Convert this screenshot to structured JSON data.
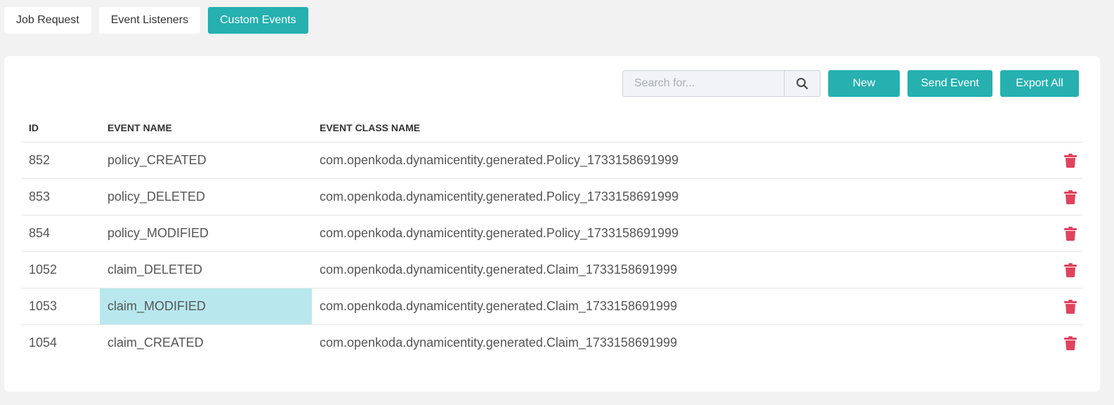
{
  "tabs": [
    {
      "label": "Job Request",
      "active": false
    },
    {
      "label": "Event Listeners",
      "active": false
    },
    {
      "label": "Custom Events",
      "active": true
    }
  ],
  "toolbar": {
    "search_placeholder": "Search for...",
    "search_icon": "search-icon",
    "new_label": "New",
    "send_event_label": "Send Event",
    "export_all_label": "Export All"
  },
  "table": {
    "headers": [
      "ID",
      "EVENT NAME",
      "EVENT CLASS NAME"
    ],
    "rows": [
      {
        "id": "852",
        "name": "policy_CREATED",
        "class_name": "com.openkoda.dynamicentity.generated.Policy_1733158691999"
      },
      {
        "id": "853",
        "name": "policy_DELETED",
        "class_name": "com.openkoda.dynamicentity.generated.Policy_1733158691999"
      },
      {
        "id": "854",
        "name": "policy_MODIFIED",
        "class_name": "com.openkoda.dynamicentity.generated.Policy_1733158691999"
      },
      {
        "id": "1052",
        "name": "claim_DELETED",
        "class_name": "com.openkoda.dynamicentity.generated.Claim_1733158691999"
      },
      {
        "id": "1053",
        "name": "claim_MODIFIED",
        "class_name": "com.openkoda.dynamicentity.generated.Claim_1733158691999",
        "highlighted": true
      },
      {
        "id": "1054",
        "name": "claim_CREATED",
        "class_name": "com.openkoda.dynamicentity.generated.Claim_1733158691999"
      }
    ],
    "delete_icon": "trash-icon"
  },
  "colors": {
    "accent": "#26b0b0",
    "danger": "#e0435e",
    "highlight": "#b8e8ee",
    "background": "#f2f2f2"
  }
}
